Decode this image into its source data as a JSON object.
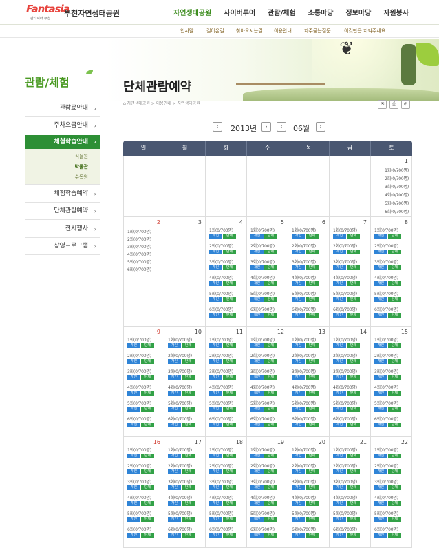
{
  "header": {
    "logo_text": "Fantasia",
    "logo_sub": "판타지아 부천",
    "park_name": "부천자연생태공원",
    "gnb": [
      "자연생태공원",
      "사이버투어",
      "관람/체험",
      "소통마당",
      "정보마당",
      "자원봉사"
    ]
  },
  "subnav": [
    "인사말",
    "걸어온길",
    "찾아오시는길",
    "이용안내",
    "자주묻는질문",
    "이것만은 지켜주세요"
  ],
  "lnb": {
    "title": "관람/체험",
    "items": [
      "관람료안내",
      "주차요금안내",
      "체험학습안내",
      "체험학습예약",
      "단체관람예약",
      "전시행사",
      "상영프로그램"
    ],
    "submenu": [
      "식물원",
      "박물관",
      "수목원"
    ]
  },
  "page": {
    "title": "단체관람예약",
    "breadcrumb": "자연생태공원 > 이용안내 > 자연생태공원",
    "year": "2013년",
    "month": "06월"
  },
  "calendar": {
    "weekdays": [
      "일",
      "월",
      "화",
      "수",
      "목",
      "금",
      "토"
    ],
    "btn_personal": "개인",
    "btn_group": "단체",
    "sessions": [
      "1회(0/700명)",
      "2회(0/700명)",
      "3회(0/700명)",
      "4회(0/700명)",
      "5회(0/700명)",
      "6회(0/700명)"
    ],
    "days_row1": [
      "",
      "",
      "",
      "",
      "",
      "",
      "1"
    ],
    "days_row2": [
      "2",
      "3",
      "4",
      "5",
      "6",
      "7",
      "8"
    ],
    "days_row3": [
      "9",
      "10",
      "11",
      "12",
      "13",
      "14",
      "15"
    ],
    "days_row4": [
      "16",
      "17",
      "18",
      "19",
      "20",
      "21",
      "22"
    ]
  }
}
